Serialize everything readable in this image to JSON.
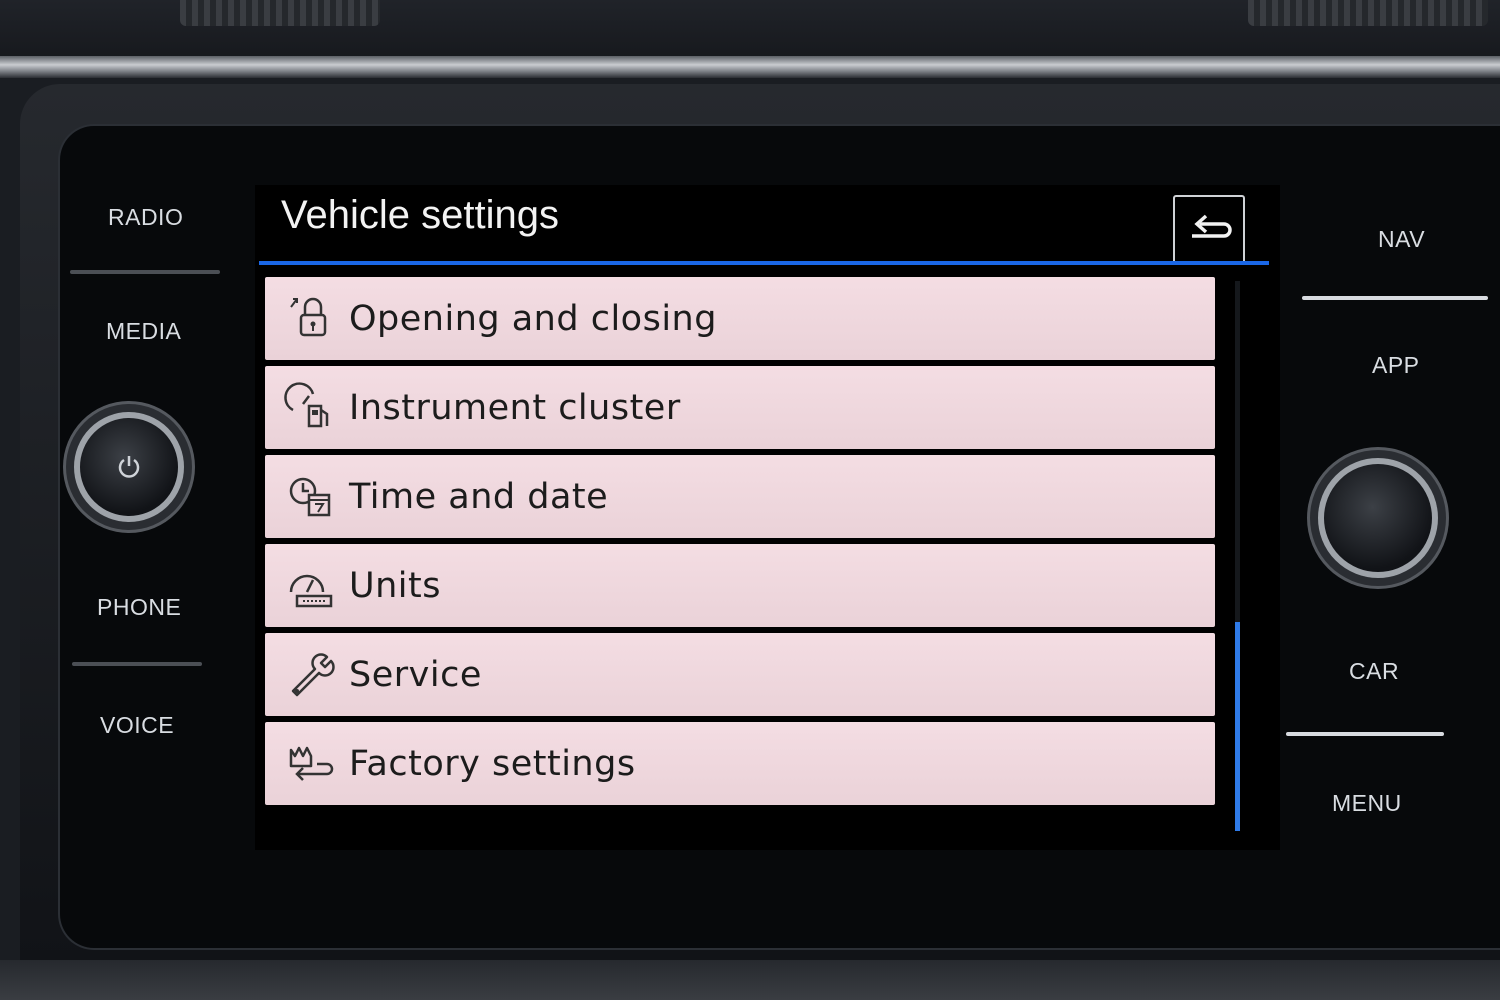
{
  "hardware": {
    "left_buttons": [
      "RADIO",
      "MEDIA",
      "PHONE",
      "VOICE"
    ],
    "right_buttons": [
      "NAV",
      "APP",
      "CAR",
      "MENU"
    ]
  },
  "screen": {
    "title": "Vehicle settings",
    "back_icon": "back-arrow-icon",
    "items": [
      {
        "label": "Opening and closing",
        "icon": "lock-icon"
      },
      {
        "label": "Instrument cluster",
        "icon": "gauge-cluster-icon"
      },
      {
        "label": "Time and date",
        "icon": "clock-calendar-icon"
      },
      {
        "label": "Units",
        "icon": "units-gauge-icon"
      },
      {
        "label": "Service",
        "icon": "wrench-icon"
      },
      {
        "label": "Factory settings",
        "icon": "factory-reset-icon"
      }
    ],
    "scroll_position": 0.62,
    "scroll_visible_fraction": 0.38
  },
  "colors": {
    "accent": "#1a67e6",
    "item_background": "#f0d8de",
    "screen_background": "#000000"
  }
}
